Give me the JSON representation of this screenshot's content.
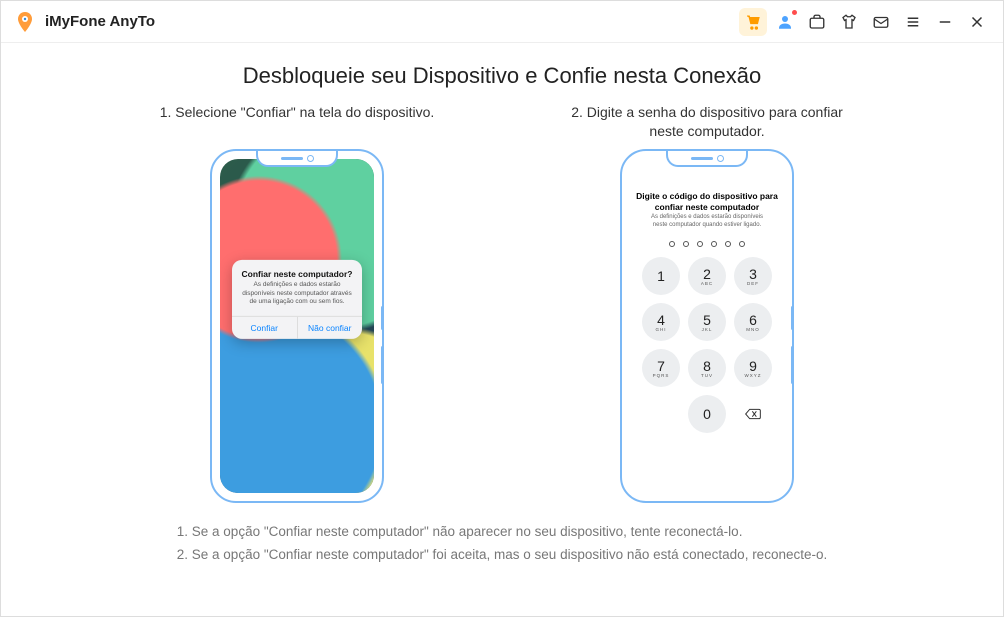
{
  "app": {
    "title": "iMyFone AnyTo"
  },
  "page": {
    "title": "Desbloqueie seu Dispositivo e Confie nesta Conexão"
  },
  "steps": {
    "one": {
      "label": "1. Selecione \"Confiar\" na tela do dispositivo.",
      "dialog": {
        "title": "Confiar neste computador?",
        "text": "As definições e dados estarão disponíveis neste computador através de uma ligação com ou sem fios.",
        "confirm": "Confiar",
        "deny": "Não confiar"
      }
    },
    "two": {
      "label": "2. Digite a senha do dispositivo para confiar neste computador.",
      "pass_title_l1": "Digite o código do dispositivo para",
      "pass_title_l2": "confiar neste computador",
      "pass_sub": "As definições e dados estarão disponíveis neste computador quando estiver ligado.",
      "keys": [
        {
          "n": "1",
          "s": ""
        },
        {
          "n": "2",
          "s": "ABC"
        },
        {
          "n": "3",
          "s": "DEF"
        },
        {
          "n": "4",
          "s": "GHI"
        },
        {
          "n": "5",
          "s": "JKL"
        },
        {
          "n": "6",
          "s": "MNO"
        },
        {
          "n": "7",
          "s": "PQRS"
        },
        {
          "n": "8",
          "s": "TUV"
        },
        {
          "n": "9",
          "s": "WXYZ"
        },
        {
          "n": "",
          "s": ""
        },
        {
          "n": "0",
          "s": ""
        },
        {
          "n": "back",
          "s": ""
        }
      ]
    }
  },
  "footnotes": {
    "one": "1. Se a opção \"Confiar neste computador\" não aparecer no seu dispositivo, tente reconectá-lo.",
    "two": "2. Se a opção \"Confiar neste computador\" foi aceita, mas o seu dispositivo não está conectado, reconecte-o."
  }
}
